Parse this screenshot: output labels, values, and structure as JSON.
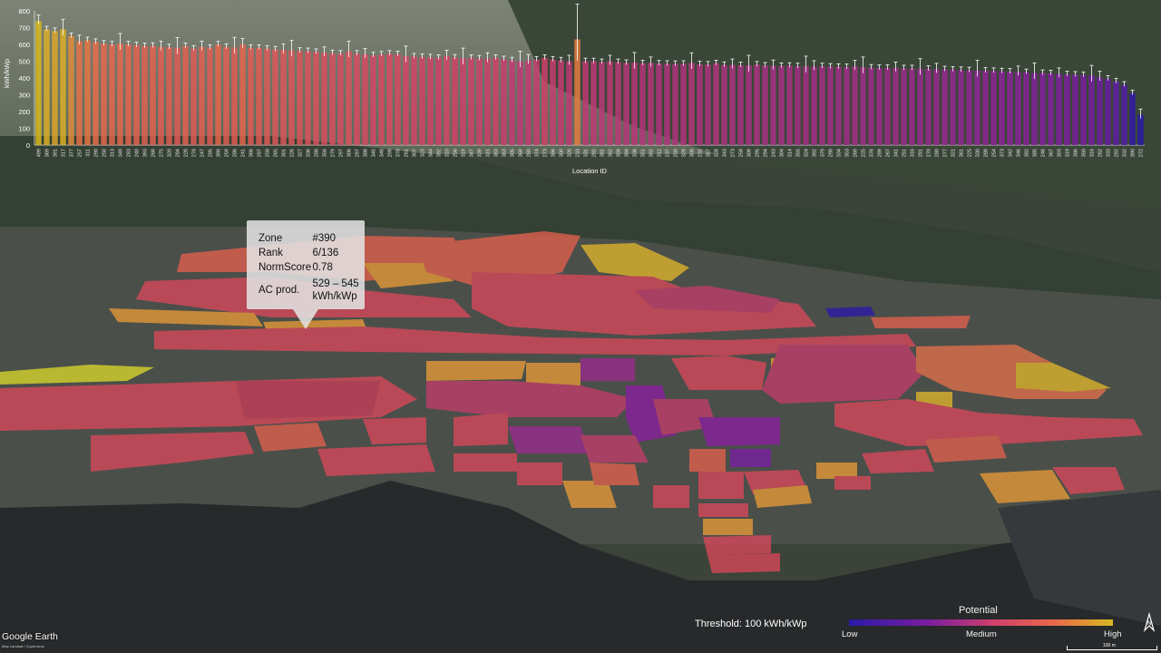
{
  "tooltip": {
    "rows": [
      {
        "key": "Zone",
        "value": "#390"
      },
      {
        "key": "Rank",
        "value": "6/136"
      },
      {
        "key": "NormScore",
        "value": "0.78"
      }
    ],
    "ac_key": "AC prod.",
    "ac_value": "529 – 545",
    "ac_unit": "kWh/kWp"
  },
  "legend": {
    "title": "Potential",
    "low": "Low",
    "medium": "Medium",
    "high": "High"
  },
  "threshold": "Threshold: 100 kWh/kWp",
  "map_credits": {
    "logo": "Google Earth",
    "attribution": "Map Landsat / Copernicus"
  },
  "north_icon": "north-arrow-icon",
  "scale": "100 m",
  "colors": {
    "low": "#2a1aa8",
    "mid_low": "#7a1ea0",
    "medium": "#d0406a",
    "mid_high": "#e86a4a",
    "high": "#d8b820"
  },
  "chart_data": {
    "type": "bar",
    "xlabel": "Location ID",
    "ylabel": "kWh/kWp",
    "ylim": [
      0,
      800
    ],
    "yticks": [
      0,
      100,
      200,
      300,
      400,
      500,
      600,
      700,
      800
    ],
    "error_bars": true,
    "categories": [
      "499",
      "369",
      "391",
      "317",
      "377",
      "257",
      "311",
      "290",
      "250",
      "313",
      "349",
      "283",
      "240",
      "393",
      "268",
      "275",
      "320",
      "284",
      "228",
      "278",
      "247",
      "285",
      "390",
      "259",
      "286",
      "241",
      "366",
      "287",
      "258",
      "265",
      "301",
      "226",
      "327",
      "336",
      "288",
      "356",
      "279",
      "297",
      "306",
      "297",
      "388",
      "345",
      "348",
      "299",
      "370",
      "261",
      "307",
      "323",
      "344",
      "392",
      "310",
      "256",
      "319",
      "347",
      "339",
      "315",
      "383",
      "363",
      "305",
      "360",
      "260",
      "374",
      "273",
      "396",
      "300",
      "326",
      "233",
      "331",
      "282",
      "381",
      "362",
      "358",
      "384",
      "338",
      "351",
      "392",
      "312",
      "237",
      "250",
      "329",
      "308",
      "232",
      "357",
      "328",
      "343",
      "273",
      "258",
      "309",
      "295",
      "294",
      "243",
      "304",
      "314",
      "355",
      "324",
      "392",
      "379",
      "298",
      "334",
      "353",
      "269",
      "225",
      "376",
      "289",
      "267",
      "341",
      "251",
      "316",
      "291",
      "270",
      "280",
      "277",
      "321",
      "361",
      "225",
      "330",
      "289",
      "254",
      "373",
      "342",
      "346",
      "382",
      "385",
      "246",
      "367",
      "303",
      "319",
      "386",
      "350",
      "316",
      "262",
      "333",
      "292",
      "332",
      "390",
      "272"
    ],
    "values": [
      740,
      690,
      680,
      690,
      650,
      620,
      625,
      615,
      605,
      600,
      605,
      600,
      595,
      590,
      592,
      585,
      583,
      580,
      590,
      575,
      585,
      580,
      600,
      585,
      582,
      600,
      580,
      580,
      575,
      570,
      568,
      565,
      562,
      560,
      555,
      550,
      548,
      545,
      560,
      545,
      540,
      535,
      540,
      545,
      542,
      530,
      528,
      525,
      523,
      520,
      530,
      522,
      518,
      520,
      516,
      515,
      520,
      512,
      505,
      500,
      505,
      510,
      520,
      510,
      505,
      500,
      630,
      500,
      500,
      495,
      500,
      495,
      490,
      492,
      488,
      490,
      486,
      485,
      484,
      485,
      490,
      482,
      480,
      488,
      478,
      478,
      476,
      475,
      480,
      474,
      472,
      472,
      473,
      470,
      470,
      468,
      470,
      468,
      466,
      465,
      470,
      465,
      462,
      460,
      460,
      460,
      458,
      458,
      455,
      455,
      452,
      452,
      450,
      448,
      446,
      445,
      444,
      442,
      440,
      438,
      436,
      435,
      430,
      430,
      428,
      425,
      422,
      420,
      418,
      415,
      405,
      395,
      380,
      360,
      310,
      180
    ]
  }
}
